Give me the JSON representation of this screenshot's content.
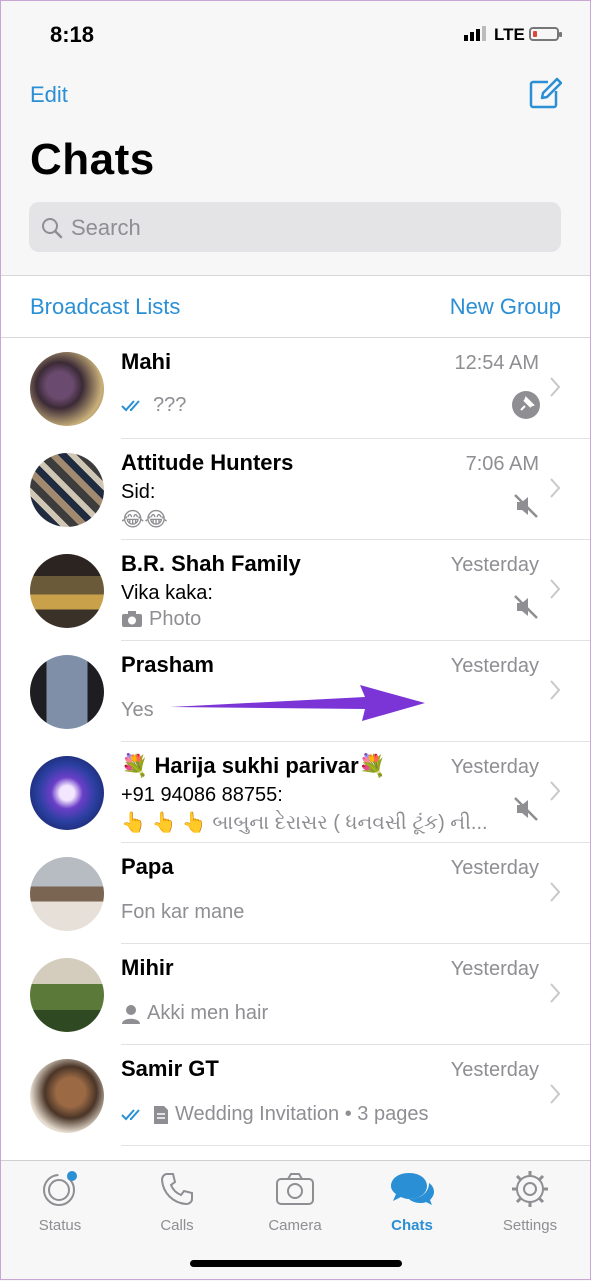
{
  "status_bar": {
    "time": "8:18",
    "network": "LTE"
  },
  "header": {
    "edit_label": "Edit",
    "title": "Chats",
    "compose_icon": "compose-icon"
  },
  "search": {
    "placeholder": "Search"
  },
  "actions": {
    "broadcast_label": "Broadcast Lists",
    "new_group_label": "New Group"
  },
  "chats": [
    {
      "name": "Mahi",
      "time": "12:54 AM",
      "preview": "???",
      "read_ticks": true,
      "right_icon": "pin-icon"
    },
    {
      "name": "Attitude Hunters",
      "time": "7:06 AM",
      "sender": "Sid:",
      "preview": "😂😂",
      "right_icon": "muted-icon"
    },
    {
      "name": "B.R. Shah Family",
      "time": "Yesterday",
      "sender": "Vika kaka:",
      "preview": "Photo",
      "preview_icon": "camera-icon",
      "right_icon": "muted-icon"
    },
    {
      "name": "Prasham",
      "time": "Yesterday",
      "preview": "Yes"
    },
    {
      "name": "💐 Harija sukhi parivar💐",
      "time": "Yesterday",
      "sender": "+91 94086 88755:",
      "preview": "👆 👆 👆 બાબુના દેરાસર ( ધનવસી ટૂંક) ની...",
      "right_icon": "muted-icon"
    },
    {
      "name": "Papa",
      "time": "Yesterday",
      "preview": "Fon kar mane"
    },
    {
      "name": "Mihir",
      "time": "Yesterday",
      "preview": "Akki men hair",
      "preview_icon": "contact-icon"
    },
    {
      "name": "Samir GT",
      "time": "Yesterday",
      "preview": "Wedding Invitation • 3 pages",
      "read_ticks": true,
      "preview_icon": "document-icon"
    }
  ],
  "tabs": [
    {
      "label": "Status",
      "icon": "status-icon"
    },
    {
      "label": "Calls",
      "icon": "phone-icon"
    },
    {
      "label": "Camera",
      "icon": "camera-icon"
    },
    {
      "label": "Chats",
      "icon": "chats-icon",
      "active": true
    },
    {
      "label": "Settings",
      "icon": "gear-icon"
    }
  ],
  "colors": {
    "accent": "#2a8fd5",
    "annotation_arrow": "#7b35d6"
  }
}
